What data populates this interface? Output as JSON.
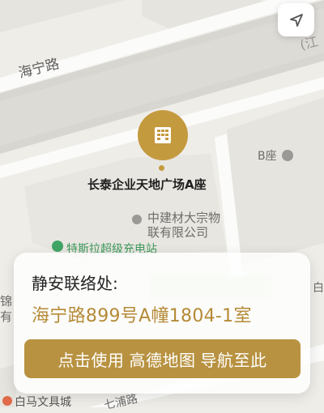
{
  "map": {
    "road_haining": "海宁路",
    "building_b": "B座",
    "poi_name": "长泰企业天地广场A座",
    "company_line1": "中建材大宗物",
    "company_line2": "联有限公司",
    "tesla": "特斯拉超级充电站",
    "partial_left1": "锦",
    "partial_left2": "有",
    "partial_right": "白",
    "baima": "白马文具城",
    "partial_road": "七浦路",
    "edge_text": "(江"
  },
  "card": {
    "title": "静安联络处:",
    "address": "海宁路899号A幢1804-1室",
    "nav_button": "点击使用 高德地图 导航至此"
  },
  "colors": {
    "accent": "#b89240",
    "address": "#b58a36",
    "map_bg": "#efede8"
  },
  "icons": [
    "location-arrow-icon",
    "building-icon",
    "poi-dot-icon",
    "charging-icon"
  ]
}
